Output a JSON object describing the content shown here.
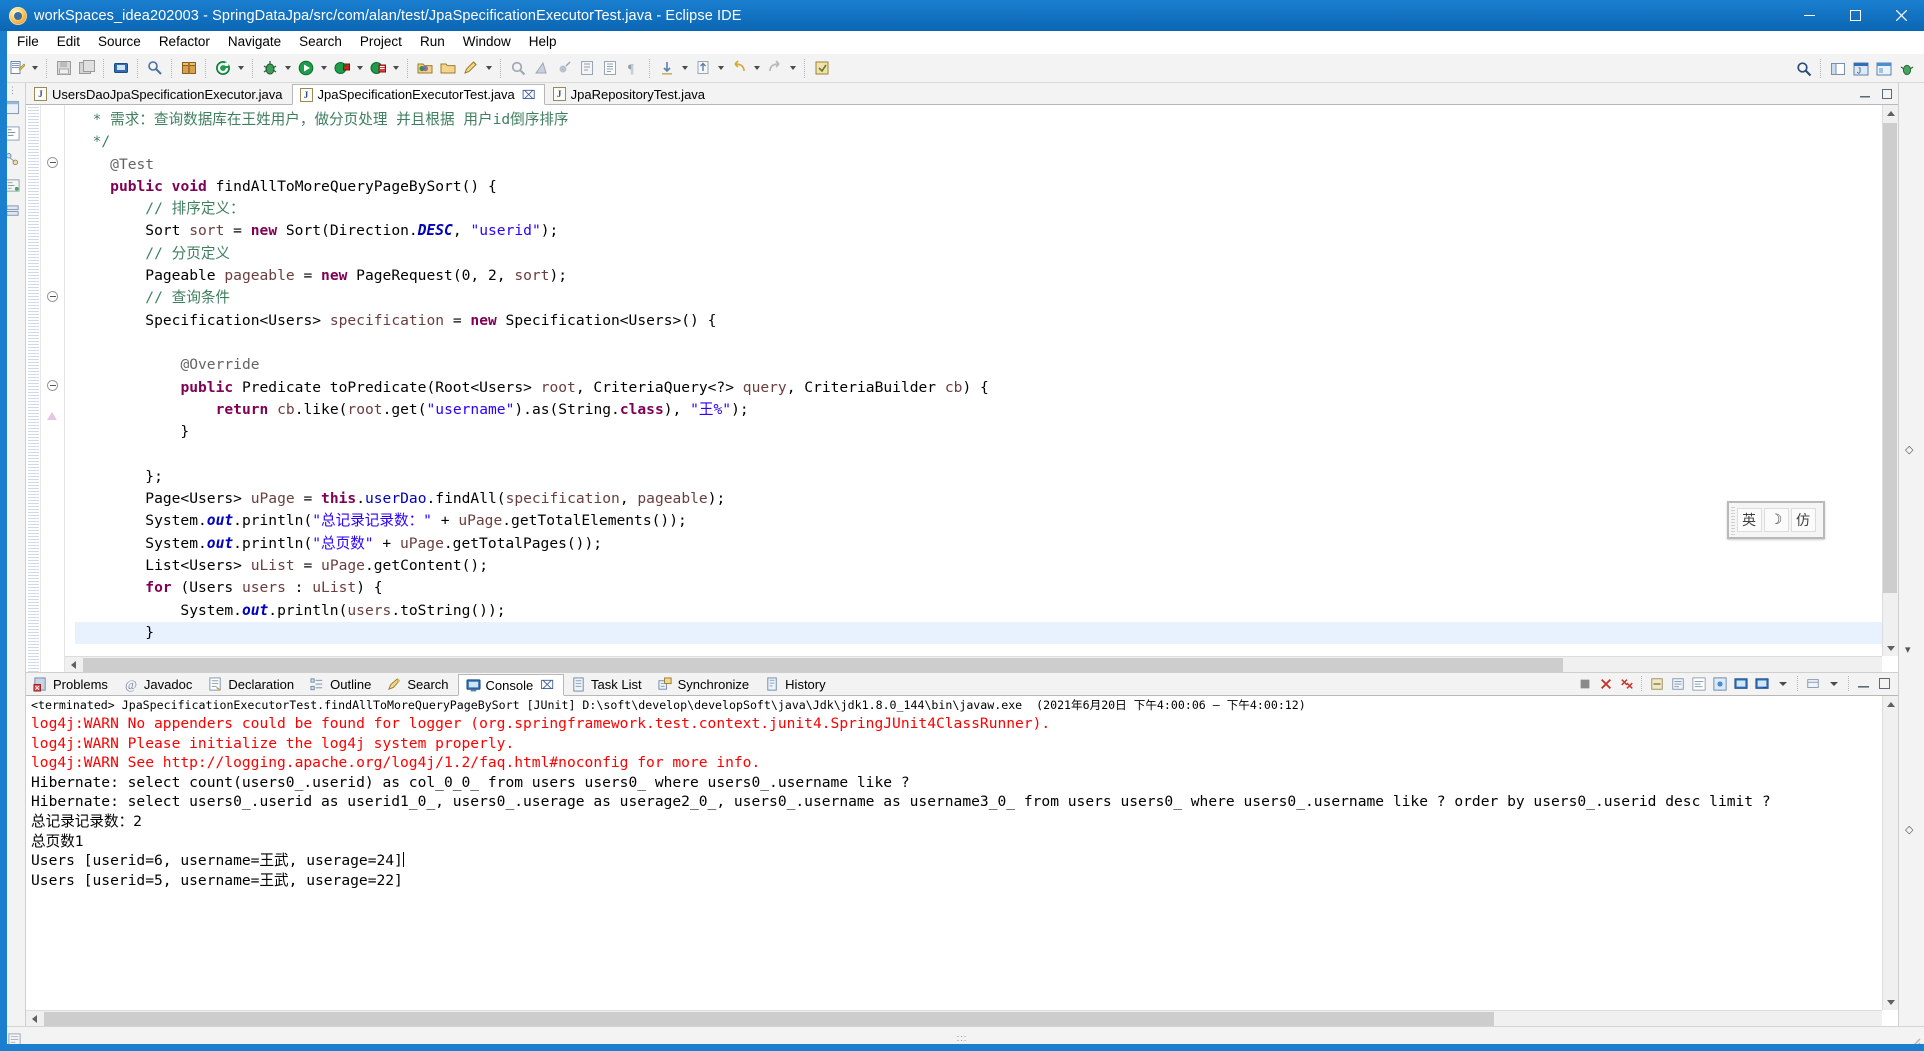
{
  "window": {
    "title": "workSpaces_idea202003 - SpringDataJpa/src/com/alan/test/JpaSpecificationExecutorTest.java - Eclipse IDE",
    "app_icon": "eclipse-icon",
    "minimize_label": "─",
    "maximize_label": "□",
    "close_label": "✕"
  },
  "menubar": {
    "items": [
      {
        "label": "File"
      },
      {
        "label": "Edit"
      },
      {
        "label": "Source"
      },
      {
        "label": "Refactor"
      },
      {
        "label": "Navigate"
      },
      {
        "label": "Search"
      },
      {
        "label": "Project"
      },
      {
        "label": "Run"
      },
      {
        "label": "Window"
      },
      {
        "label": "Help"
      }
    ]
  },
  "toolbar": {
    "buttons": [
      {
        "name": "new-wizard-icon",
        "has_arrow": true
      },
      {
        "name": "save-icon",
        "has_arrow": false
      },
      {
        "name": "save-all-icon",
        "has_arrow": false
      },
      {
        "name": "print-icon",
        "has_arrow": false
      },
      {
        "name": "link-icon",
        "has_arrow": false
      },
      {
        "name": "package-icon",
        "has_arrow": false
      },
      {
        "name": "external-tools-icon",
        "has_arrow": true
      },
      {
        "name": "debug-icon",
        "has_arrow": true
      },
      {
        "name": "run-icon",
        "has_arrow": true
      },
      {
        "name": "coverage-icon",
        "has_arrow": true
      },
      {
        "name": "profile-icon",
        "has_arrow": true
      },
      {
        "name": "new-java-package-icon",
        "has_arrow": false
      },
      {
        "name": "new-java-class-icon",
        "has_arrow": false
      },
      {
        "name": "new-annotation-icon",
        "has_arrow": true
      },
      {
        "name": "search-ref-icon",
        "has_arrow": false
      },
      {
        "name": "marker-icon",
        "has_arrow": false
      },
      {
        "name": "next-annotation-icon",
        "has_arrow": false
      },
      {
        "name": "open-task-icon",
        "has_arrow": false
      },
      {
        "name": "open-type-icon",
        "has_arrow": false
      },
      {
        "name": "pilcrow-icon",
        "has_arrow": false
      },
      {
        "name": "next-edit-icon",
        "has_arrow": true
      },
      {
        "name": "prev-edit-icon",
        "has_arrow": true
      },
      {
        "name": "back-icon",
        "has_arrow": true
      },
      {
        "name": "forward-icon",
        "has_arrow": true
      },
      {
        "name": "pin-editor-icon",
        "has_arrow": false
      }
    ],
    "right_buttons": [
      {
        "name": "quick-access-search-icon"
      },
      {
        "name": "open-perspective-icon"
      },
      {
        "name": "perspective-java-icon"
      },
      {
        "name": "perspective-javaee-icon"
      },
      {
        "name": "perspective-debug-icon"
      }
    ]
  },
  "editor_tabs": {
    "items": [
      {
        "label": "UsersDaoJpaSpecificationExecutor.java",
        "active": false,
        "closable": false,
        "icon": "java-file-icon"
      },
      {
        "label": "JpaSpecificationExecutorTest.java",
        "active": true,
        "closable": true,
        "icon": "java-file-icon"
      },
      {
        "label": "JpaRepositoryTest.java",
        "active": false,
        "closable": false,
        "icon": "java-file-icon"
      }
    ],
    "minimize_icon": "minimize-icon",
    "maximize_icon": "maximize-icon"
  },
  "editor": {
    "lines": [
      {
        "indent": 0,
        "text": "  * 需求：查询数据库在王姓用户，做分页处理 并且根据 用户id倒序排序"
      },
      {
        "indent": 0,
        "text": "  */"
      },
      {
        "indent": 0,
        "text": "\t@Test"
      },
      {
        "indent": 0,
        "text": "\tpublic void findAllToMoreQueryPageBySort() {"
      },
      {
        "indent": 0,
        "text": "\t\t// 排序定义："
      },
      {
        "indent": 0,
        "text": "\t\tSort sort = new Sort(Direction.DESC, \"userid\");"
      },
      {
        "indent": 0,
        "text": "\t\t// 分页定义"
      },
      {
        "indent": 0,
        "text": "\t\tPageable pageable = new PageRequest(0, 2, sort);"
      },
      {
        "indent": 0,
        "text": "\t\t// 查询条件"
      },
      {
        "indent": 0,
        "text": "\t\tSpecification<Users> specification = new Specification<Users>() {"
      },
      {
        "indent": 0,
        "text": ""
      },
      {
        "indent": 0,
        "text": "\t\t\t@Override"
      },
      {
        "indent": 0,
        "text": "\t\t\tpublic Predicate toPredicate(Root<Users> root, CriteriaQuery<?> query, CriteriaBuilder cb) {"
      },
      {
        "indent": 0,
        "text": "\t\t\t\treturn cb.like(root.get(\"username\").as(String.class), \"王%\");"
      },
      {
        "indent": 0,
        "text": "\t\t\t}"
      },
      {
        "indent": 0,
        "text": ""
      },
      {
        "indent": 0,
        "text": "\t\t};"
      },
      {
        "indent": 0,
        "text": "\t\tPage<Users> uPage = this.userDao.findAll(specification, pageable);"
      },
      {
        "indent": 0,
        "text": "\t\tSystem.out.println(\"总记录记录数：\" + uPage.getTotalElements());"
      },
      {
        "indent": 0,
        "text": "\t\tSystem.out.println(\"总页数\" + uPage.getTotalPages());"
      },
      {
        "indent": 0,
        "text": "\t\tList<Users> uList = uPage.getContent();"
      },
      {
        "indent": 0,
        "text": "\t\tfor (Users users : uList) {"
      },
      {
        "indent": 0,
        "text": "\t\t\tSystem.out.println(users.toString());"
      },
      {
        "indent": 0,
        "text": "\t\t}"
      },
      {
        "indent": 0,
        "text": "\t}"
      }
    ]
  },
  "console_tabs": {
    "items": [
      {
        "label": "Problems",
        "icon": "problems-icon",
        "active": false,
        "closable": false
      },
      {
        "label": "Javadoc",
        "icon": "javadoc-icon",
        "active": false,
        "closable": false
      },
      {
        "label": "Declaration",
        "icon": "declaration-icon",
        "active": false,
        "closable": false
      },
      {
        "label": "Outline",
        "icon": "outline-icon",
        "active": false,
        "closable": false
      },
      {
        "label": "Search",
        "icon": "search-icon",
        "active": false,
        "closable": false
      },
      {
        "label": "Console",
        "icon": "console-icon",
        "active": true,
        "closable": true
      },
      {
        "label": "Task List",
        "icon": "task-list-icon",
        "active": false,
        "closable": false
      },
      {
        "label": "Synchronize",
        "icon": "synchronize-icon",
        "active": false,
        "closable": false
      },
      {
        "label": "History",
        "icon": "history-icon",
        "active": false,
        "closable": false
      }
    ],
    "toolbar": [
      {
        "name": "terminate-icon"
      },
      {
        "name": "remove-launch-icon"
      },
      {
        "name": "remove-all-terminated-icon"
      },
      {
        "name": "clear-console-icon"
      },
      {
        "name": "scroll-lock-icon"
      },
      {
        "name": "word-wrap-icon"
      },
      {
        "name": "pin-console-icon"
      },
      {
        "name": "display-selected-console-icon"
      },
      {
        "name": "open-console-icon"
      },
      {
        "name": "view-menu-icon"
      },
      {
        "name": "minimize-icon"
      },
      {
        "name": "maximize-icon"
      }
    ]
  },
  "console": {
    "header": "<terminated> JpaSpecificationExecutorTest.findAllToMoreQueryPageBySort [JUnit] D:\\soft\\develop\\developSoft\\java\\Jdk\\jdk1.8.0_144\\bin\\javaw.exe  (2021年6月20日 下午4:00:06 – 下午4:00:12)",
    "lines": [
      {
        "type": "error",
        "text": "log4j:WARN No appenders could be found for logger (org.springframework.test.context.junit4.SpringJUnit4ClassRunner)."
      },
      {
        "type": "error",
        "text": "log4j:WARN Please initialize the log4j system properly."
      },
      {
        "type": "error",
        "text": "log4j:WARN See http://logging.apache.org/log4j/1.2/faq.html#noconfig for more info."
      },
      {
        "type": "stdout",
        "text": "Hibernate: select count(users0_.userid) as col_0_0_ from users users0_ where users0_.username like ?"
      },
      {
        "type": "stdout",
        "text": "Hibernate: select users0_.userid as userid1_0_, users0_.userage as userage2_0_, users0_.username as username3_0_ from users users0_ where users0_.username like ? order by users0_.userid desc limit ?"
      },
      {
        "type": "stdout",
        "text": "总记录记录数：2"
      },
      {
        "type": "stdout",
        "text": "总页数1"
      },
      {
        "type": "stdout",
        "text": "Users [userid=6, username=王武, userage=24]",
        "caret": true
      },
      {
        "type": "stdout",
        "text": "Users [userid=5, username=王武, userage=22]"
      }
    ]
  },
  "ime": {
    "cells": [
      {
        "label": "英",
        "name": "ime-mode-english"
      },
      {
        "label": "☽",
        "name": "ime-moon-icon"
      },
      {
        "label": "仿",
        "name": "ime-shape-icon"
      }
    ]
  },
  "statusbar": {
    "left_icon": "writable-icon",
    "grip": "∶∶∶"
  },
  "colors": {
    "title_bar": "#0a6ebd",
    "accent": "#1b7fd0",
    "console_error": "#ff0000",
    "keyword": "#7f0055",
    "string": "#2a00ff",
    "comment": "#3f7f5f",
    "field": "#0000c0",
    "local_var": "#6a3e3e",
    "selection": "#e8f2fe"
  }
}
